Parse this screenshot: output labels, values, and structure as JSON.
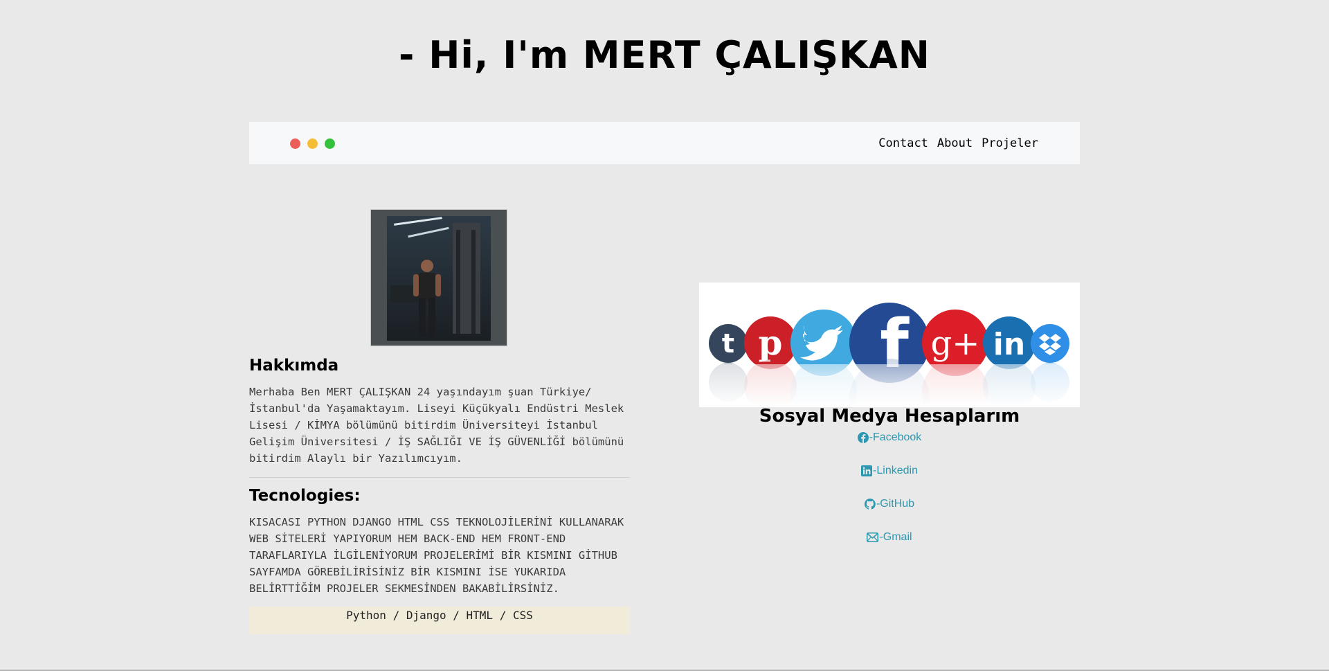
{
  "header": {
    "title": "- Hi, I'm MERT ÇALIŞKAN"
  },
  "navbar": {
    "dots": [
      {
        "name": "close",
        "color": "#ec5f59"
      },
      {
        "name": "minimize",
        "color": "#f4bd35"
      },
      {
        "name": "maximize",
        "color": "#34c13c"
      }
    ],
    "links": [
      "Contact",
      "About",
      "Projeler"
    ]
  },
  "about": {
    "heading": "Hakkımda",
    "text": "Merhaba Ben MERT ÇALIŞKAN 24 yaşındayım şuan Türkiye/ İstanbul'da Yaşamaktayım. Liseyi Küçükyalı Endüstri Meslek Lisesi / KİMYA bölümünü bitirdim Üniversiteyi İstanbul Gelişim Üniversitesi / İŞ SAĞLIĞI VE İŞ GÜVENLİĞİ bölümünü bitirdim Alaylı bir Yazılımcıyım."
  },
  "tech": {
    "heading": "Tecnologies:",
    "text": "KISACASI PYTHON DJANGO HTML CSS TEKNOLOJİLERİNİ KULLANARAK WEB SİTELERİ YAPIYORUM HEM BACK-END HEM FRONT-END TARAFLARIYLA İLGİLENİYORUM PROJELERİMİ BİR KISMINI GİTHUB SAYFAMDA GÖREBİLİRİSİNİZ BİR KISMINI İSE YUKARIDA BELİRTTİĞİM PROJELER SEKMESİNDEN BAKABİLİRSİNİZ.",
    "stack": "Python / Django / HTML / CSS"
  },
  "social": {
    "heading": "Sosyal Medya Hesaplarım",
    "banner_icons": [
      {
        "name": "tumblr",
        "glyph": "t",
        "color": "#35465c"
      },
      {
        "name": "pinterest",
        "glyph": "p",
        "color": "#cb2027"
      },
      {
        "name": "twitter",
        "glyph": "",
        "color": "#3fa9e0"
      },
      {
        "name": "facebook",
        "glyph": "f",
        "color": "#234a93"
      },
      {
        "name": "google-plus",
        "glyph": "g+",
        "color": "#dc1e28"
      },
      {
        "name": "linkedin",
        "glyph": "in",
        "color": "#1a6fb0"
      },
      {
        "name": "dropbox",
        "glyph": "",
        "color": "#2f8fe6"
      }
    ],
    "links": [
      {
        "label": "-Facebook",
        "icon": "facebook-icon"
      },
      {
        "label": "-Linkedin",
        "icon": "linkedin-icon"
      },
      {
        "label": "-GitHub",
        "icon": "github-icon"
      },
      {
        "label": "-Gmail",
        "icon": "mail-icon"
      }
    ]
  }
}
